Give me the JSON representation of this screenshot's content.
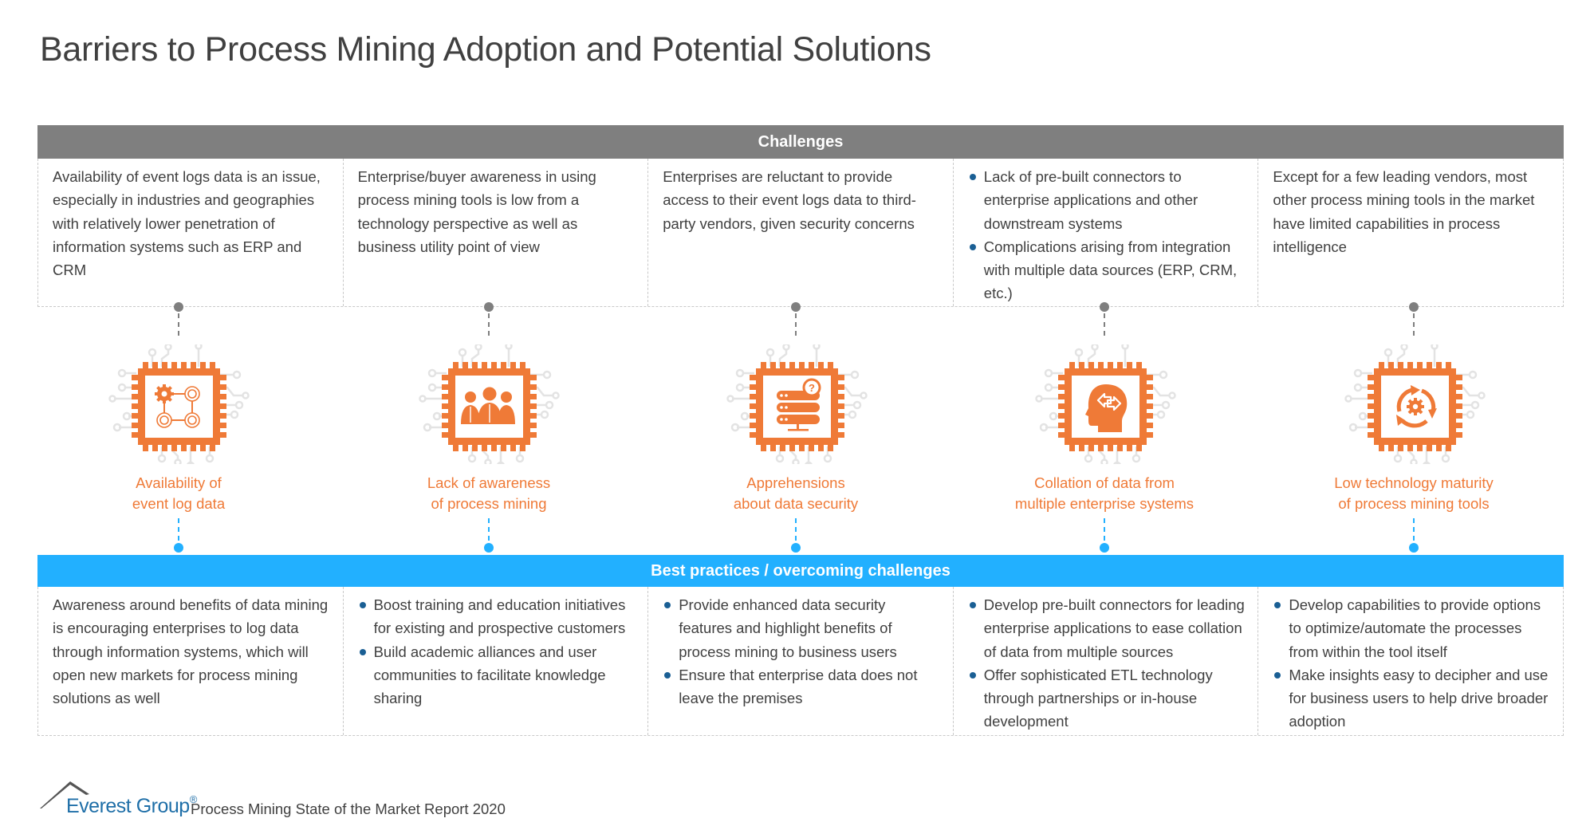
{
  "title": "Barriers to Process Mining Adoption and Potential Solutions",
  "colors": {
    "challenges_band": "#7f7f7f",
    "best_band": "#22b0ff",
    "accent_orange": "#ef7a37",
    "bullet_blue": "#1a5f94",
    "text": "#404040"
  },
  "challenges": {
    "header": "Challenges",
    "cells": [
      {
        "type": "text",
        "text": "Availability of event logs data is an issue, especially in industries and geographies with relatively lower penetration of information systems such as ERP and CRM"
      },
      {
        "type": "text",
        "text": "Enterprise/buyer awareness in using process mining tools is low from a technology perspective as well as business utility point of view"
      },
      {
        "type": "text",
        "text": "Enterprises are reluctant to provide access to their event logs data to third-party vendors, given security concerns"
      },
      {
        "type": "bullets",
        "bullets": [
          "Lack of pre-built connectors to enterprise applications and other downstream systems",
          "Complications arising from integration with multiple data sources (ERP, CRM, etc.)"
        ]
      },
      {
        "type": "text",
        "text": "Except for a few leading vendors, most other process mining tools in the market have limited capabilities in process intelligence"
      }
    ]
  },
  "barriers": [
    {
      "icon": "gears-network-icon",
      "label_line1": "Availability of",
      "label_line2": "event log data"
    },
    {
      "icon": "people-group-icon",
      "label_line1": "Lack of awareness",
      "label_line2": "of process mining"
    },
    {
      "icon": "server-question-icon",
      "label_line1": "Apprehensions",
      "label_line2": "about data security"
    },
    {
      "icon": "head-arrows-icon",
      "label_line1": "Collation of data from",
      "label_line2": "multiple enterprise systems"
    },
    {
      "icon": "gear-cycle-icon",
      "label_line1": "Low technology maturity",
      "label_line2": "of process mining tools"
    }
  ],
  "best_practices": {
    "header": "Best practices / overcoming challenges",
    "cells": [
      {
        "type": "text",
        "text": "Awareness around benefits of data mining is encouraging enterprises to log data through information systems, which will open new markets for process mining solutions as well"
      },
      {
        "type": "bullets",
        "bullets": [
          "Boost training and education initiatives for existing and prospective customers",
          "Build academic alliances and user communities to facilitate knowledge sharing"
        ]
      },
      {
        "type": "bullets",
        "bullets": [
          "Provide enhanced data security features and highlight benefits of process mining to business users",
          "Ensure that enterprise data does not leave the premises"
        ]
      },
      {
        "type": "bullets",
        "bullets": [
          "Develop pre-built connectors for leading enterprise applications to ease collation of data from multiple sources",
          "Offer sophisticated ETL technology through partnerships or in-house development"
        ]
      },
      {
        "type": "bullets",
        "bullets": [
          "Develop capabilities to provide options to optimize/automate the processes from within the tool itself",
          "Make insights easy to decipher and use for business users to help drive broader adoption"
        ]
      }
    ]
  },
  "footer": {
    "brand": "Everest Group",
    "registered": "®",
    "report": "Process Mining State of the Market Report 2020"
  }
}
